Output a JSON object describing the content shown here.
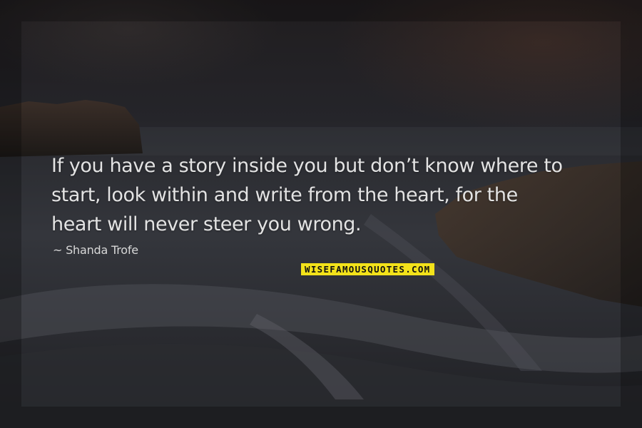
{
  "quote": {
    "lines": [
      "If you have a story inside you but don’t know where to",
      "start, look within and write from the heart, for the",
      "heart will never steer you wrong."
    ]
  },
  "author": "~ Shanda Trofe",
  "brand": "WISEFAMOUSQUOTES.COM",
  "colors": {
    "text": "#e3e3e3",
    "brand_background": "#f3e21a",
    "brand_text": "#111111"
  }
}
